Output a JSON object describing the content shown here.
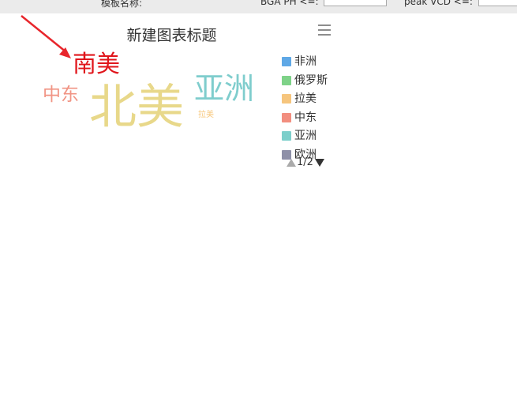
{
  "toolbar": {
    "template_name_label": "模板名称:",
    "bga_ph_label": "BGA PH <=:",
    "bga_ph_value": "",
    "peak_vcd_label": "peak VCD <=:",
    "peak_vcd_value": ""
  },
  "chart": {
    "title": "新建图表标题",
    "menu_icon": "hamburger-menu-icon",
    "pager_text": "1/2"
  },
  "chart_data": {
    "type": "wordcloud",
    "title": "新建图表标题",
    "words": [
      {
        "name": "北美",
        "size_rank": 1,
        "color": "#e8d88a"
      },
      {
        "name": "南美",
        "size_rank": 2,
        "color": "#e0151b"
      },
      {
        "name": "亚洲",
        "size_rank": 3,
        "color": "#7fcdcd"
      },
      {
        "name": "中东",
        "size_rank": 4,
        "color": "#f19484"
      },
      {
        "name": "拉美",
        "size_rank": 5,
        "color": "#f7c77c"
      }
    ],
    "legend": [
      {
        "name": "非洲",
        "color": "#5fa8e6"
      },
      {
        "name": "俄罗斯",
        "color": "#7ed288"
      },
      {
        "name": "拉美",
        "color": "#f6c57d"
      },
      {
        "name": "中东",
        "color": "#f28e7f"
      },
      {
        "name": "亚洲",
        "color": "#7dcfcb"
      },
      {
        "name": "欧洲",
        "color": "#8e90a8"
      }
    ],
    "legend_placement": "right"
  },
  "annotation": {
    "arrow_color": "#e8262c"
  }
}
